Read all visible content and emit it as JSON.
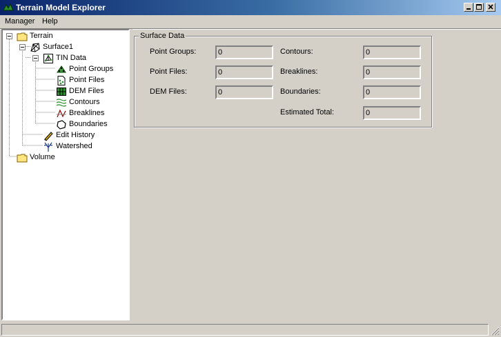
{
  "window": {
    "title": "Terrain Model Explorer"
  },
  "menu": {
    "items": [
      "Manager",
      "Help"
    ]
  },
  "tree": {
    "terrain": "Terrain",
    "surface1": "Surface1",
    "tin_data": "TIN Data",
    "point_groups": "Point Groups",
    "point_files": "Point Files",
    "dem_files": "DEM Files",
    "contours": "Contours",
    "breaklines": "Breaklines",
    "boundaries": "Boundaries",
    "edit_history": "Edit History",
    "watershed": "Watershed",
    "volume": "Volume"
  },
  "surface_data": {
    "title": "Surface Data",
    "point_groups": {
      "label": "Point Groups:",
      "value": "0"
    },
    "point_files": {
      "label": "Point Files:",
      "value": "0"
    },
    "dem_files": {
      "label": "DEM Files:",
      "value": "0"
    },
    "contours": {
      "label": "Contours:",
      "value": "0"
    },
    "breaklines": {
      "label": "Breaklines:",
      "value": "0"
    },
    "boundaries": {
      "label": "Boundaries:",
      "value": "0"
    },
    "estimated_total": {
      "label": "Estimated Total:",
      "value": "0"
    }
  },
  "status": {
    "text": ""
  }
}
